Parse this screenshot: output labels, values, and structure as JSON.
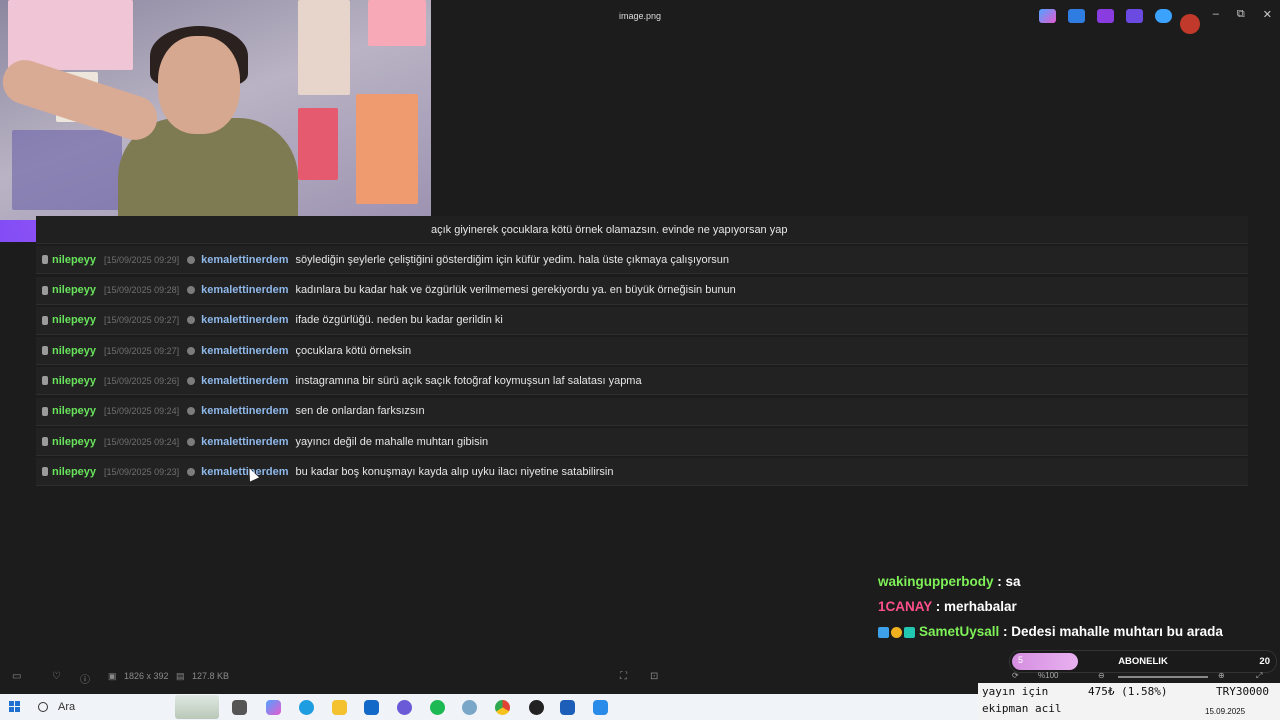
{
  "window": {
    "title": "image.png",
    "controls": [
      "–",
      "⧉",
      "✕"
    ]
  },
  "chat_log": {
    "rows": [
      {
        "user": "",
        "timestamp": "",
        "author": "",
        "message": "açık giyinerek çocuklara kötü örnek olamazsın. evinde ne yapıyorsan yap"
      },
      {
        "user": "nilepeyy",
        "timestamp": "[15/09/2025 09:29]",
        "author": "kemalettinerdem",
        "message": "söylediğin şeylerle çeliştiğini gösterdiğim için küfür yedim. hala üste çıkmaya çalışıyorsun"
      },
      {
        "user": "nilepeyy",
        "timestamp": "[15/09/2025 09:28]",
        "author": "kemalettinerdem",
        "message": "kadınlara bu kadar hak ve özgürlük verilmemesi gerekiyordu ya. en büyük örneğisin bunun"
      },
      {
        "user": "nilepeyy",
        "timestamp": "[15/09/2025 09:27]",
        "author": "kemalettinerdem",
        "message": "ifade özgürlüğü. neden bu kadar gerildin ki"
      },
      {
        "user": "nilepeyy",
        "timestamp": "[15/09/2025 09:27]",
        "author": "kemalettinerdem",
        "message": "çocuklara kötü örneksin"
      },
      {
        "user": "nilepeyy",
        "timestamp": "[15/09/2025 09:26]",
        "author": "kemalettinerdem",
        "message": "instagramına bir sürü açık saçık fotoğraf koymuşsun laf salatası yapma"
      },
      {
        "user": "nilepeyy",
        "timestamp": "[15/09/2025 09:24]",
        "author": "kemalettinerdem",
        "message": "sen de onlardan farksızsın"
      },
      {
        "user": "nilepeyy",
        "timestamp": "[15/09/2025 09:24]",
        "author": "kemalettinerdem",
        "message": "yayıncı değil de mahalle muhtarı gibisin"
      },
      {
        "user": "nilepeyy",
        "timestamp": "[15/09/2025 09:23]",
        "author": "kemalettinerdem",
        "message": "bu kadar boş konuşmayı kayda alıp uyku ilacı niyetine satabilirsin"
      }
    ]
  },
  "stream_chat": [
    {
      "user": "wakingupperbody",
      "message": " : sa"
    },
    {
      "user": "1CANAY",
      "message": " : merhabalar"
    },
    {
      "user": "SametUysall",
      "message": " : Dedesi mahalle muhtarı bu arada"
    }
  ],
  "viewer_bar": {
    "dimensions": "1826 x 392",
    "size": "127.8 KB"
  },
  "subscription": {
    "left_count": "5",
    "label": "ABONELIK",
    "right_count": "20",
    "progress": 0.25
  },
  "zoom": {
    "level": "%100"
  },
  "donation": {
    "line1": "yayın için",
    "line2": "ekipman acil",
    "amount": "475₺ (1.58%)",
    "goal": "TRY30000",
    "date": "15.09.2025"
  },
  "taskbar": {
    "search_label": "Ara"
  },
  "colors": {
    "user_green": "#68e35b",
    "author_blue": "#8fb8ea",
    "accent_purple": "#a04dff"
  }
}
